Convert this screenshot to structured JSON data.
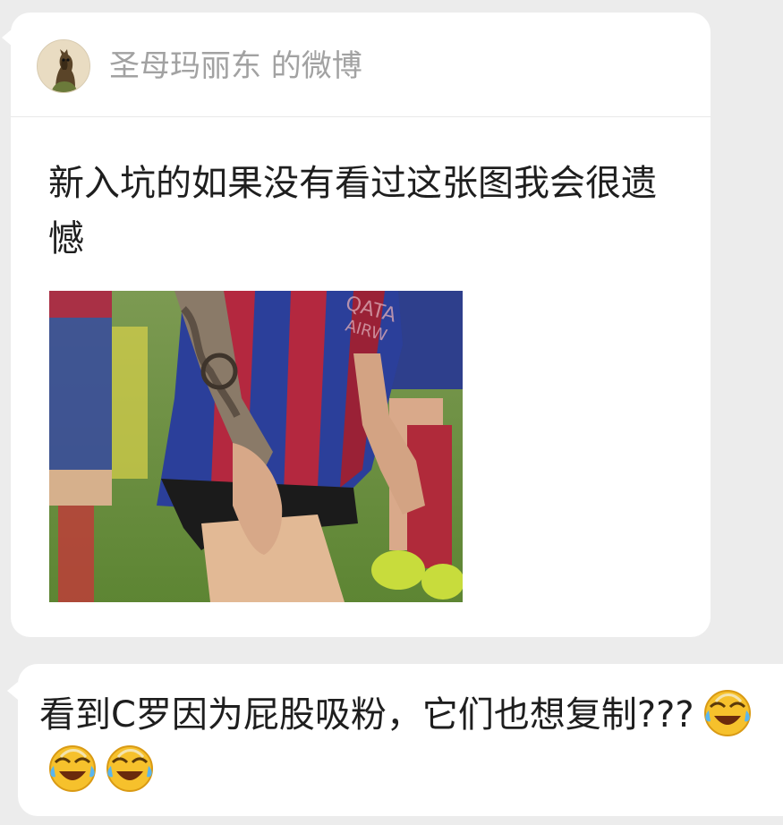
{
  "card": {
    "title": "圣母玛丽东 的微博",
    "text": "新入坑的如果没有看过这张图我会很遗憾",
    "avatar_icon": "horse-avatar-icon",
    "photo_description_icon": "soccer-player-photo"
  },
  "message": {
    "text": "看到C罗因为屁股吸粉，它们也想复制???",
    "emoji_icon": "laughing-crying-emoji-icon",
    "emoji_count": 3
  },
  "colors": {
    "background": "#ececec",
    "bubble": "#ffffff",
    "title_gray": "#a2a2a2",
    "text": "#1e1e1e"
  }
}
